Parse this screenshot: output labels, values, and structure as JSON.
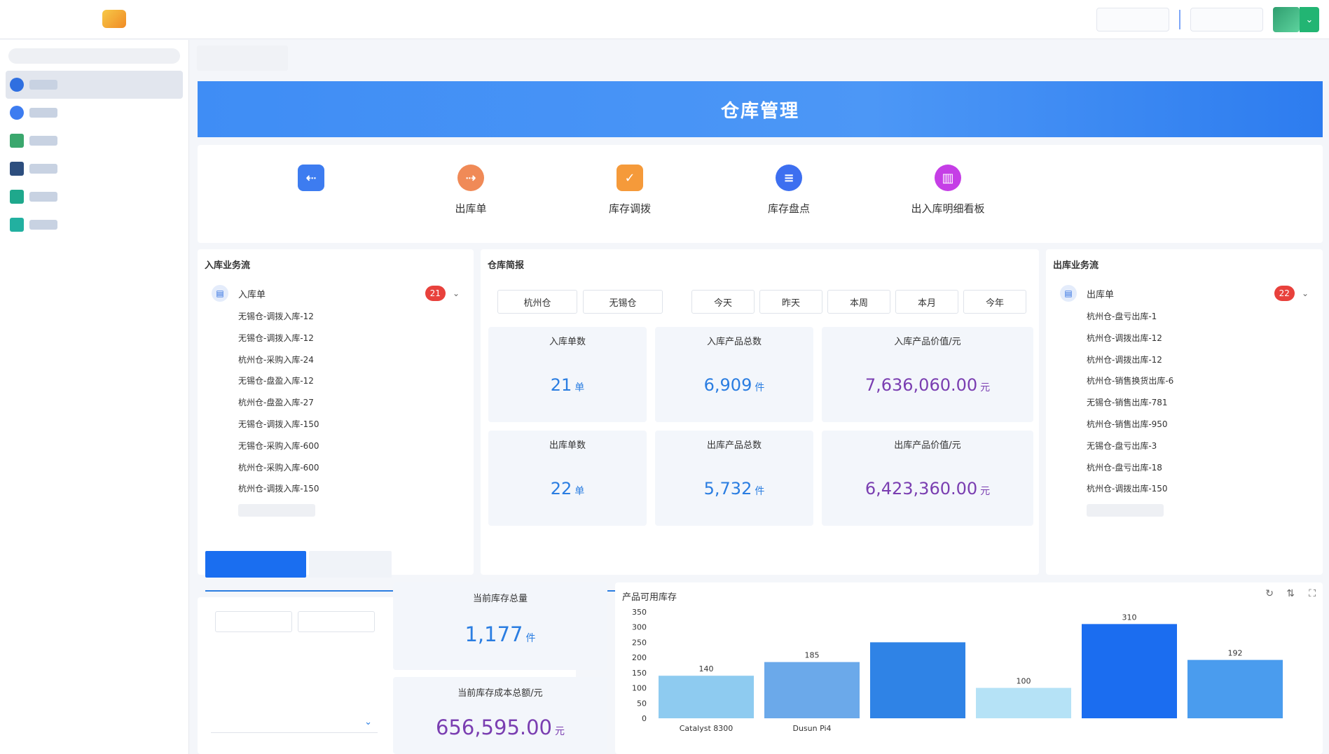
{
  "page": {
    "title": "仓库管理"
  },
  "quick_links": [
    {
      "label": "",
      "icon": "inbound-icon",
      "color": "#3d7cf0"
    },
    {
      "label": "出库单",
      "icon": "outbound-icon",
      "color": "#f08a57"
    },
    {
      "label": "库存调拨",
      "icon": "transfer-icon",
      "color": "#f59a3a"
    },
    {
      "label": "库存盘点",
      "icon": "stocktake-icon",
      "color": "#3d6ff0"
    },
    {
      "label": "出入库明细看板",
      "icon": "dashboard-icon",
      "color": "#c53ee6"
    }
  ],
  "inbound_flow": {
    "title": "入库业务流",
    "doc_name": "入库单",
    "count": "21",
    "items": [
      "无锡仓-调拨入库-12",
      "无锡仓-调拨入库-12",
      "杭州仓-采购入库-24",
      "无锡仓-盘盈入库-12",
      "杭州仓-盘盈入库-27",
      "无锡仓-调拨入库-150",
      "无锡仓-采购入库-600",
      "杭州仓-采购入库-600",
      "杭州仓-调拨入库-150"
    ]
  },
  "outbound_flow": {
    "title": "出库业务流",
    "doc_name": "出库单",
    "count": "22",
    "items": [
      "杭州仓-盘亏出库-1",
      "杭州仓-调拨出库-12",
      "杭州仓-调拨出库-12",
      "杭州仓-销售换货出库-6",
      "无锡仓-销售出库-781",
      "杭州仓-销售出库-950",
      "无锡仓-盘亏出库-3",
      "杭州仓-盘亏出库-18",
      "杭州仓-调拨出库-150"
    ]
  },
  "report": {
    "title": "仓库简报",
    "warehouses": [
      "杭州仓",
      "无锡仓"
    ],
    "periods": [
      "今天",
      "昨天",
      "本周",
      "本月",
      "今年"
    ],
    "stats": [
      {
        "label": "入库单数",
        "value": "21",
        "unit": "单"
      },
      {
        "label": "入库产品总数",
        "value": "6,909",
        "unit": "件"
      },
      {
        "label": "入库产品价值/元",
        "value": "7,636,060.00",
        "unit": "元"
      },
      {
        "label": "出库单数",
        "value": "22",
        "unit": "单"
      },
      {
        "label": "出库产品总数",
        "value": "5,732",
        "unit": "件"
      },
      {
        "label": "出库产品价值/元",
        "value": "6,423,360.00",
        "unit": "元"
      }
    ]
  },
  "inventory": {
    "total_label": "当前库存总量",
    "total_value": "1,177",
    "total_unit": "件",
    "cost_label": "当前库存成本总额/元",
    "cost_value": "656,595.00",
    "cost_unit": "元"
  },
  "chart_data": {
    "type": "bar",
    "title": "产品可用库存",
    "categories": [
      "Catalyst 8300",
      "Dusun Pi4",
      "",
      "",
      "",
      ""
    ],
    "values": [
      140,
      185,
      250,
      100,
      310,
      192
    ],
    "bar_colors": [
      "#8ecbf0",
      "#6ba9ea",
      "#2f83e6",
      "#b5e2f6",
      "#1b6df0",
      "#4a9cee"
    ],
    "ylim": [
      0,
      350
    ],
    "yticks": [
      0,
      50,
      100,
      150,
      200,
      250,
      300,
      350
    ],
    "value_labels": [
      "140",
      "185",
      "",
      "100",
      "310",
      "192"
    ],
    "grid": false
  },
  "colors": {
    "accent": "#2a7de1",
    "banner": "#4c97f6",
    "badge": "#e8413c",
    "purple": "#7a3eb1"
  }
}
